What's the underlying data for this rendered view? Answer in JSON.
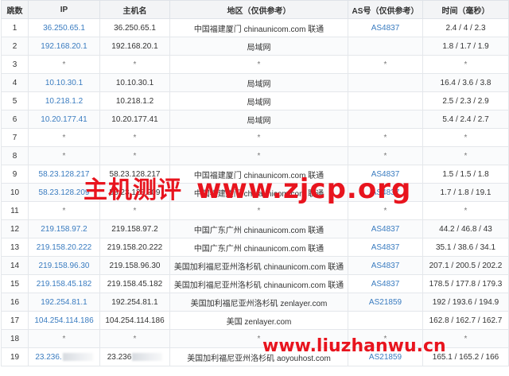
{
  "headers": [
    "跳数",
    "IP",
    "主机名",
    "地区（仅供参考）",
    "AS号（仅供参考）",
    "时间（毫秒）"
  ],
  "rows": [
    {
      "hop": "1",
      "ip": "36.250.65.1",
      "host": "36.250.65.1",
      "region": "中国福建厦门 chinaunicom.com 联通",
      "as": "AS4837",
      "time": "2.4 / 4 / 2.3"
    },
    {
      "hop": "2",
      "ip": "192.168.20.1",
      "host": "192.168.20.1",
      "region": "局域网",
      "as": "",
      "time": "1.8 / 1.7 / 1.9"
    },
    {
      "hop": "3",
      "ip": "*",
      "host": "*",
      "region": "*",
      "as": "*",
      "time": "*"
    },
    {
      "hop": "4",
      "ip": "10.10.30.1",
      "host": "10.10.30.1",
      "region": "局域网",
      "as": "",
      "time": "16.4 / 3.6 / 3.8"
    },
    {
      "hop": "5",
      "ip": "10.218.1.2",
      "host": "10.218.1.2",
      "region": "局域网",
      "as": "",
      "time": "2.5 / 2.3 / 2.9"
    },
    {
      "hop": "6",
      "ip": "10.20.177.41",
      "host": "10.20.177.41",
      "region": "局域网",
      "as": "",
      "time": "5.4 / 2.4 / 2.7"
    },
    {
      "hop": "7",
      "ip": "*",
      "host": "*",
      "region": "*",
      "as": "*",
      "time": "*"
    },
    {
      "hop": "8",
      "ip": "*",
      "host": "*",
      "region": "*",
      "as": "*",
      "time": "*"
    },
    {
      "hop": "9",
      "ip": "58.23.128.217",
      "host": "58.23.128.217",
      "region": "中国福建厦门 chinaunicom.com 联通",
      "as": "AS4837",
      "time": "1.5 / 1.5 / 1.8"
    },
    {
      "hop": "10",
      "ip": "58.23.128.209",
      "host": "58.23.128.209",
      "region": "中国福建厦门 chinaunicom.com 联通",
      "as": "AS4837",
      "time": "1.7 / 1.8 / 19.1"
    },
    {
      "hop": "11",
      "ip": "*",
      "host": "*",
      "region": "*",
      "as": "*",
      "time": "*"
    },
    {
      "hop": "12",
      "ip": "219.158.97.2",
      "host": "219.158.97.2",
      "region": "中国广东广州 chinaunicom.com 联通",
      "as": "AS4837",
      "time": "44.2 / 46.8 / 43"
    },
    {
      "hop": "13",
      "ip": "219.158.20.222",
      "host": "219.158.20.222",
      "region": "中国广东广州 chinaunicom.com 联通",
      "as": "AS4837",
      "time": "35.1 / 38.6 / 34.1"
    },
    {
      "hop": "14",
      "ip": "219.158.96.30",
      "host": "219.158.96.30",
      "region": "美国加利福尼亚州洛杉矶 chinaunicom.com 联通",
      "as": "AS4837",
      "time": "207.1 / 200.5 / 202.2"
    },
    {
      "hop": "15",
      "ip": "219.158.45.182",
      "host": "219.158.45.182",
      "region": "美国加利福尼亚州洛杉矶 chinaunicom.com 联通",
      "as": "AS4837",
      "time": "178.5 / 177.8 / 179.3"
    },
    {
      "hop": "16",
      "ip": "192.254.81.1",
      "host": "192.254.81.1",
      "region": "美国加利福尼亚州洛杉矶 zenlayer.com",
      "as": "AS21859",
      "time": "192 / 193.6 / 194.9"
    },
    {
      "hop": "17",
      "ip": "104.254.114.186",
      "host": "104.254.114.186",
      "region": "美国 zenlayer.com",
      "as": "",
      "time": "162.8 / 162.7 / 162.7"
    },
    {
      "hop": "18",
      "ip": "*",
      "host": "*",
      "region": "*",
      "as": "*",
      "time": "*"
    },
    {
      "hop": "19",
      "ip": "23.236.",
      "host": "23.236",
      "region": "美国加利福尼亚州洛杉矶 aoyouhost.com",
      "as": "AS21859",
      "time": "165.1 / 165.2 / 166"
    }
  ],
  "watermark_main": {
    "cn": "主机测评",
    "url": "www.zjcp.org"
  },
  "watermark_secondary": "www.liuzhanwu.cn",
  "colors": {
    "link": "#3a7cc0",
    "watermark": "#e8141e",
    "header_bg": "#f3f4f6"
  }
}
